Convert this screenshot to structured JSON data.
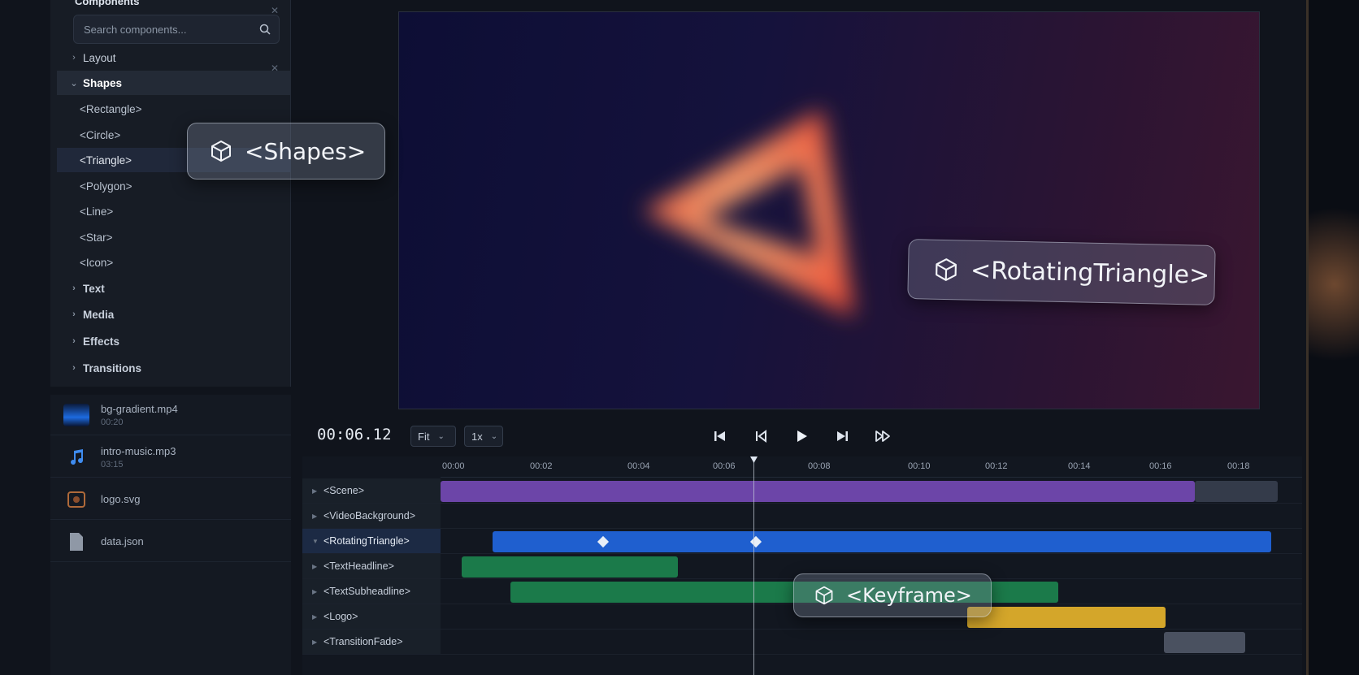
{
  "components_panel": {
    "title": "Components",
    "search_placeholder": "Search components...",
    "categories": [
      {
        "label": "Layout",
        "expanded": false
      },
      {
        "label": "Shapes",
        "expanded": true,
        "children": [
          "<Rectangle>",
          "<Circle>",
          "<Triangle>",
          "<Polygon>",
          "<Line>",
          "<Star>",
          "<Icon>"
        ],
        "selected_child": "<Triangle>"
      },
      {
        "label": "Text",
        "expanded": false
      },
      {
        "label": "Media",
        "expanded": false
      },
      {
        "label": "Effects",
        "expanded": false
      },
      {
        "label": "Transitions",
        "expanded": false
      }
    ]
  },
  "media": [
    {
      "name": "bg-gradient.mp4",
      "duration": "00:20",
      "icon": "video-thumbnail"
    },
    {
      "name": "intro-music.mp3",
      "duration": "03:15",
      "icon": "music-note-icon"
    },
    {
      "name": "logo.svg",
      "duration": "",
      "icon": "image-icon"
    },
    {
      "name": "data.json",
      "duration": "",
      "icon": "file-icon"
    }
  ],
  "callouts": {
    "shapes": "<Shapes>",
    "rotating_triangle": "<RotatingTriangle>",
    "keyframe": "<Keyframe>",
    "icon": "cube-icon"
  },
  "transport": {
    "timecode": "00:06.12",
    "zoom": "Fit",
    "speed": "1x",
    "buttons": [
      "skip-to-start-icon",
      "previous-frame-icon",
      "play-icon",
      "next-frame-icon",
      "fast-forward-icon"
    ]
  },
  "timeline": {
    "ticks": [
      "00:00",
      "00:02",
      "00:04",
      "00:06",
      "00:08",
      "00:10",
      "00:12",
      "00:14",
      "00:16",
      "00:18"
    ],
    "tracks": [
      {
        "label": "<Scene>",
        "color": "#6c45a8"
      },
      {
        "label": "<VideoBackground>",
        "color": ""
      },
      {
        "label": "<RotatingTriangle>",
        "color": "#1f5fcf",
        "selected": true
      },
      {
        "label": "<TextHeadline>",
        "color": "#1b7a4a"
      },
      {
        "label": "<TextSubheadline>",
        "color": "#1b7a4a"
      },
      {
        "label": "<Logo>",
        "color": "#d4a62a"
      },
      {
        "label": "<TransitionFade>",
        "color": "#4a5160"
      }
    ]
  },
  "colors": {
    "accent_blue": "#1f5fcf",
    "triangle_glow": "#ff7a4a"
  }
}
